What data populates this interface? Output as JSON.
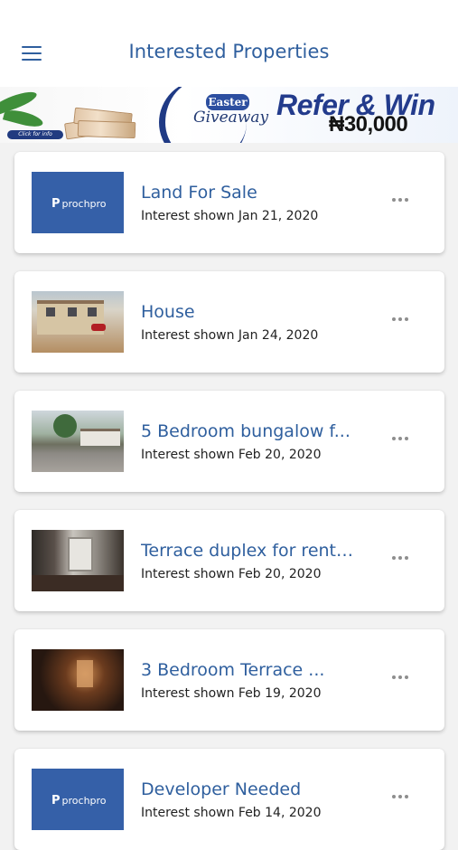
{
  "header": {
    "title": "Interested Properties"
  },
  "banner": {
    "click_info": "Click for info",
    "badge": "Easter",
    "giveaway": "Giveaway",
    "headline": "Refer & Win",
    "prize": "₦30,000"
  },
  "properties": [
    {
      "title": "Land For Sale",
      "subtitle": "Interest shown Jan 21, 2020",
      "thumb": "prochpro-logo"
    },
    {
      "title": "House",
      "subtitle": "Interest shown Jan 24, 2020",
      "thumb": "house-photo"
    },
    {
      "title": "5 Bedroom bungalow f...",
      "subtitle": "Interest shown Feb 20, 2020",
      "thumb": "bungalow-photo"
    },
    {
      "title": "Terrace duplex for rent ...",
      "subtitle": "Interest shown Feb 20, 2020",
      "thumb": "interior-photo"
    },
    {
      "title": "3 Bedroom Terrace ...",
      "subtitle": "Interest shown Feb 19, 2020",
      "thumb": "bedroom-photo"
    },
    {
      "title": "Developer Needed",
      "subtitle": "Interest shown Feb 14, 2020",
      "thumb": "prochpro-logo"
    }
  ],
  "logo_text": "prochpro",
  "colors": {
    "accent": "#2f5f9e",
    "background": "#f2f2f2",
    "card": "#ffffff",
    "logo_bg": "#3560a8"
  }
}
